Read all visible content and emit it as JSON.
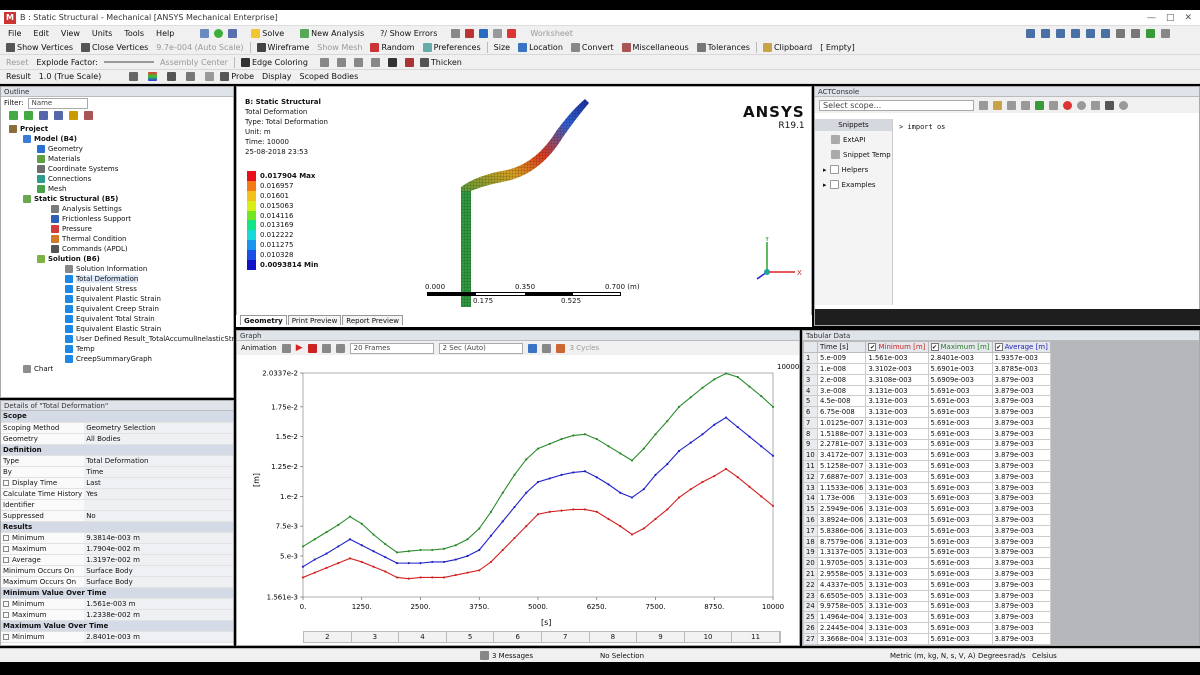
{
  "window": {
    "title": "B : Static Structural - Mechanical [ANSYS Mechanical Enterprise]",
    "app_letter": "M"
  },
  "menu": [
    "File",
    "Edit",
    "View",
    "Units",
    "Tools",
    "Help"
  ],
  "toolbar1": {
    "solve": "Solve",
    "new_analysis": "New Analysis",
    "show_errors": "?/ Show Errors",
    "worksheet": "Worksheet"
  },
  "toolbar2": {
    "show_vertices": "Show Vertices",
    "close_vertices": "Close Vertices",
    "scale": "9.7e-004 (Auto Scale)",
    "wireframe": "Wireframe",
    "show_mesh": "Show Mesh",
    "random": "Random",
    "preferences": "Preferences",
    "size": "Size",
    "location": "Location",
    "convert": "Convert",
    "miscellaneous": "Miscellaneous",
    "tolerances": "Tolerances",
    "clipboard": "Clipboard",
    "empty": "[ Empty]"
  },
  "toolbar3": {
    "reset": "Reset",
    "explode": "Explode Factor:",
    "assembly": "Assembly Center",
    "edge_coloring": "Edge Coloring",
    "thicken": "Thicken"
  },
  "toolbar4": {
    "result": "Result",
    "true_scale": "1.0 (True Scale)",
    "probe": "Probe",
    "display": "Display",
    "scoped": "Scoped Bodies"
  },
  "outline": {
    "header": "Outline",
    "filter_label": "Filter:",
    "filter_value": "Name",
    "items": [
      {
        "label": "Project",
        "lvl": 0,
        "color": "#8a6d3b",
        "bold": true
      },
      {
        "label": "Model (B4)",
        "lvl": 1,
        "color": "#3d7bd9",
        "bold": true
      },
      {
        "label": "Geometry",
        "lvl": 2,
        "color": "#2a6fd6"
      },
      {
        "label": "Materials",
        "lvl": 2,
        "color": "#5fa040"
      },
      {
        "label": "Coordinate Systems",
        "lvl": 2,
        "color": "#6d6d6d"
      },
      {
        "label": "Connections",
        "lvl": 2,
        "color": "#2a9d8f"
      },
      {
        "label": "Mesh",
        "lvl": 2,
        "color": "#4aa04a"
      },
      {
        "label": "Static Structural (B5)",
        "lvl": 1,
        "color": "#6aa84f",
        "bold": true
      },
      {
        "label": "Analysis Settings",
        "lvl": 3,
        "color": "#7a7a7a"
      },
      {
        "label": "Frictionless Support",
        "lvl": 3,
        "color": "#2b5fb8"
      },
      {
        "label": "Pressure",
        "lvl": 3,
        "color": "#d23c3c"
      },
      {
        "label": "Thermal Condition",
        "lvl": 3,
        "color": "#d27a2c"
      },
      {
        "label": "Commands (APDL)",
        "lvl": 3,
        "color": "#555"
      },
      {
        "label": "Solution (B6)",
        "lvl": 2,
        "color": "#7cb342",
        "bold": true
      },
      {
        "label": "Solution Information",
        "lvl": 4,
        "color": "#888"
      },
      {
        "label": "Total Deformation",
        "lvl": 4,
        "color": "#1e88e5",
        "sel": true
      },
      {
        "label": "Equivalent Stress",
        "lvl": 4,
        "color": "#1e88e5"
      },
      {
        "label": "Equivalent Plastic Strain",
        "lvl": 4,
        "color": "#1e88e5"
      },
      {
        "label": "Equivalent Creep Strain",
        "lvl": 4,
        "color": "#1e88e5"
      },
      {
        "label": "Equivalent Total Strain",
        "lvl": 4,
        "color": "#1e88e5"
      },
      {
        "label": "Equivalent Elastic Strain",
        "lvl": 4,
        "color": "#1e88e5"
      },
      {
        "label": "User Defined Result_TotalAccumulInelasticStrain",
        "lvl": 4,
        "color": "#1e88e5"
      },
      {
        "label": "Temp",
        "lvl": 4,
        "color": "#1e88e5"
      },
      {
        "label": "CreepSummaryGraph",
        "lvl": 4,
        "color": "#1e88e5"
      },
      {
        "label": "Chart",
        "lvl": 1,
        "color": "#8e8e8e"
      }
    ]
  },
  "details": {
    "header": "Details of \"Total Deformation\"",
    "rows": [
      {
        "g": "Scope"
      },
      {
        "k": "Scoping Method",
        "v": "Geometry Selection"
      },
      {
        "k": "Geometry",
        "v": "All Bodies"
      },
      {
        "g": "Definition"
      },
      {
        "k": "Type",
        "v": "Total Deformation"
      },
      {
        "k": "By",
        "v": "Time"
      },
      {
        "k": "Display Time",
        "v": "Last",
        "cb": true
      },
      {
        "k": "Calculate Time History",
        "v": "Yes"
      },
      {
        "k": "Identifier",
        "v": ""
      },
      {
        "k": "Suppressed",
        "v": "No"
      },
      {
        "g": "Results"
      },
      {
        "k": "Minimum",
        "v": "9.3814e-003 m",
        "cb": true
      },
      {
        "k": "Maximum",
        "v": "1.7904e-002 m",
        "cb": true
      },
      {
        "k": "Average",
        "v": "1.3197e-002 m",
        "cb": true
      },
      {
        "k": "Minimum Occurs On",
        "v": "Surface Body"
      },
      {
        "k": "Maximum Occurs On",
        "v": "Surface Body"
      },
      {
        "g": "Minimum Value Over Time"
      },
      {
        "k": "Minimum",
        "v": "1.561e-003 m",
        "cb": true
      },
      {
        "k": "Maximum",
        "v": "1.2338e-002 m",
        "cb": true
      },
      {
        "g": "Maximum Value Over Time"
      },
      {
        "k": "Minimum",
        "v": "2.8401e-003 m",
        "cb": true
      }
    ]
  },
  "viewport": {
    "title": "B: Static Structural",
    "l1": "Total Deformation",
    "l2": "Type: Total Deformation",
    "l3": "Unit: m",
    "l4": "Time: 10000",
    "l5": "25-08-2018 23:53",
    "brand": "ANSYS",
    "version": "R19.1",
    "legend": [
      "0.017904 Max",
      "0.016957",
      "0.01601",
      "0.015063",
      "0.014116",
      "0.013169",
      "0.012222",
      "0.011275",
      "0.010328",
      "0.0093814 Min"
    ],
    "legend_colors": [
      "#e8111b",
      "#f57a16",
      "#f2c21b",
      "#d7ef14",
      "#72e620",
      "#14e488",
      "#18d8d8",
      "#1a94ee",
      "#1a4fe8",
      "#1111c8"
    ],
    "scale_labels": [
      "0.000",
      "0.350",
      "0.700 (m)",
      "0.175",
      "0.525"
    ],
    "tabs": [
      "Geometry",
      "Print Preview",
      "Report Preview"
    ]
  },
  "act": {
    "header": "ACTConsole",
    "scope": "Select scope...",
    "snippets": "Snippets",
    "items": [
      "ExtAPI",
      "Snippet Temp"
    ],
    "folders": [
      "Helpers",
      "Examples"
    ],
    "code": "import os"
  },
  "graph": {
    "header": "Graph",
    "animation": "Animation",
    "frames": "20 Frames",
    "duration": "2 Sec (Auto)",
    "cycles": "3 Cycles",
    "max_label": "10000",
    "yunit": "[m]",
    "xunit": "[s]",
    "bottom": [
      "2",
      "3",
      "4",
      "5",
      "6",
      "7",
      "8",
      "9",
      "10",
      "11"
    ]
  },
  "chart_data": {
    "type": "line",
    "x": [
      0,
      250,
      500,
      750,
      1000,
      1250,
      1500,
      1750,
      2000,
      2250,
      2500,
      2750,
      3000,
      3250,
      3500,
      3750,
      4000,
      4250,
      4500,
      4750,
      5000,
      5250,
      5500,
      5750,
      6000,
      6250,
      6500,
      6750,
      7000,
      7250,
      7500,
      7750,
      8000,
      8250,
      8500,
      8750,
      9000,
      9250,
      9500,
      9750,
      10000
    ],
    "series": [
      {
        "name": "Minimum [m]",
        "color": "#d22020",
        "values": [
          0.0032,
          0.0036,
          0.004,
          0.0044,
          0.0048,
          0.0045,
          0.0041,
          0.0037,
          0.0032,
          0.0031,
          0.0032,
          0.0032,
          0.0032,
          0.0034,
          0.0036,
          0.0038,
          0.0045,
          0.0055,
          0.0065,
          0.0075,
          0.0085,
          0.0087,
          0.0088,
          0.0089,
          0.0089,
          0.0087,
          0.0081,
          0.0075,
          0.0068,
          0.0073,
          0.0081,
          0.0089,
          0.0099,
          0.0106,
          0.0112,
          0.0117,
          0.0123,
          0.0116,
          0.0108,
          0.01,
          0.0092
        ]
      },
      {
        "name": "Maximum [m]",
        "color": "#2a8a2a",
        "values": [
          0.0058,
          0.0064,
          0.007,
          0.0076,
          0.0083,
          0.0077,
          0.0068,
          0.006,
          0.0053,
          0.0054,
          0.0055,
          0.0055,
          0.0056,
          0.0059,
          0.0064,
          0.0073,
          0.0087,
          0.0103,
          0.0118,
          0.0131,
          0.014,
          0.0144,
          0.0148,
          0.0151,
          0.0152,
          0.0148,
          0.0142,
          0.0136,
          0.013,
          0.014,
          0.0152,
          0.0163,
          0.0175,
          0.0183,
          0.0191,
          0.0198,
          0.0203,
          0.02,
          0.0192,
          0.0184,
          0.0175
        ]
      },
      {
        "name": "Average [m]",
        "color": "#2020c8",
        "values": [
          0.0041,
          0.0047,
          0.0052,
          0.0058,
          0.0064,
          0.0059,
          0.0054,
          0.0049,
          0.0044,
          0.0044,
          0.0044,
          0.0045,
          0.0045,
          0.0047,
          0.005,
          0.0055,
          0.0067,
          0.0079,
          0.0091,
          0.0103,
          0.0112,
          0.0115,
          0.0118,
          0.012,
          0.0121,
          0.0116,
          0.011,
          0.0103,
          0.0099,
          0.0106,
          0.0118,
          0.0127,
          0.0138,
          0.0145,
          0.0152,
          0.016,
          0.0166,
          0.0158,
          0.015,
          0.0142,
          0.0134
        ]
      }
    ],
    "ytick_labels": [
      "2.0337e-2",
      "1.75e-2",
      "1.5e-2",
      "1.25e-2",
      "1.e-2",
      "7.5e-3",
      "5.e-3",
      "1.561e-3"
    ],
    "ytick_values": [
      0.020337,
      0.0175,
      0.015,
      0.0125,
      0.01,
      0.0075,
      0.005,
      0.001561
    ],
    "xtick_labels": [
      "0.",
      "1250.",
      "2500.",
      "3750.",
      "5000.",
      "6250.",
      "7500.",
      "8750.",
      "10000"
    ],
    "ylim": [
      0.001561,
      0.020337
    ],
    "xlim": [
      0,
      10000
    ],
    "ylabel": "[m]",
    "xlabel": "[s]"
  },
  "tabular": {
    "header": "Tabular Data",
    "cols": [
      "Time [s]",
      "Minimum [m]",
      "Maximum [m]",
      "Average [m]"
    ],
    "rows": [
      [
        "1",
        "5.e-009",
        "1.561e-003",
        "2.8401e-003",
        "1.9357e-003"
      ],
      [
        "2",
        "1.e-008",
        "3.3102e-003",
        "5.6901e-003",
        "3.8785e-003"
      ],
      [
        "3",
        "2.e-008",
        "3.3108e-003",
        "5.6909e-003",
        "3.879e-003"
      ],
      [
        "4",
        "3.e-008",
        "3.131e-003",
        "5.691e-003",
        "3.879e-003"
      ],
      [
        "5",
        "4.5e-008",
        "3.131e-003",
        "5.691e-003",
        "3.879e-003"
      ],
      [
        "6",
        "6.75e-008",
        "3.131e-003",
        "5.691e-003",
        "3.879e-003"
      ],
      [
        "7",
        "1.0125e-007",
        "3.131e-003",
        "5.691e-003",
        "3.879e-003"
      ],
      [
        "8",
        "1.5188e-007",
        "3.131e-003",
        "5.691e-003",
        "3.879e-003"
      ],
      [
        "9",
        "2.2781e-007",
        "3.131e-003",
        "5.691e-003",
        "3.879e-003"
      ],
      [
        "10",
        "3.4172e-007",
        "3.131e-003",
        "5.691e-003",
        "3.879e-003"
      ],
      [
        "11",
        "5.1258e-007",
        "3.131e-003",
        "5.691e-003",
        "3.879e-003"
      ],
      [
        "12",
        "7.6887e-007",
        "3.131e-003",
        "5.691e-003",
        "3.879e-003"
      ],
      [
        "13",
        "1.1533e-006",
        "3.131e-003",
        "5.691e-003",
        "3.879e-003"
      ],
      [
        "14",
        "1.73e-006",
        "3.131e-003",
        "5.691e-003",
        "3.879e-003"
      ],
      [
        "15",
        "2.5949e-006",
        "3.131e-003",
        "5.691e-003",
        "3.879e-003"
      ],
      [
        "16",
        "3.8924e-006",
        "3.131e-003",
        "5.691e-003",
        "3.879e-003"
      ],
      [
        "17",
        "5.8386e-006",
        "3.131e-003",
        "5.691e-003",
        "3.879e-003"
      ],
      [
        "18",
        "8.7579e-006",
        "3.131e-003",
        "5.691e-003",
        "3.879e-003"
      ],
      [
        "19",
        "1.3137e-005",
        "3.131e-003",
        "5.691e-003",
        "3.879e-003"
      ],
      [
        "20",
        "1.9705e-005",
        "3.131e-003",
        "5.691e-003",
        "3.879e-003"
      ],
      [
        "21",
        "2.9558e-005",
        "3.131e-003",
        "5.691e-003",
        "3.879e-003"
      ],
      [
        "22",
        "4.4337e-005",
        "3.131e-003",
        "5.691e-003",
        "3.879e-003"
      ],
      [
        "23",
        "6.6505e-005",
        "3.131e-003",
        "5.691e-003",
        "3.879e-003"
      ],
      [
        "24",
        "9.9758e-005",
        "3.131e-003",
        "5.691e-003",
        "3.879e-003"
      ],
      [
        "25",
        "1.4964e-004",
        "3.131e-003",
        "5.691e-003",
        "3.879e-003"
      ],
      [
        "26",
        "2.2445e-004",
        "3.131e-003",
        "5.691e-003",
        "3.879e-003"
      ],
      [
        "27",
        "3.3668e-004",
        "3.131e-003",
        "5.691e-003",
        "3.879e-003"
      ]
    ]
  },
  "status": {
    "messages": "3 Messages",
    "selection": "No Selection",
    "units": "Metric (m, kg, N, s, V, A)",
    "degrees": "Degrees",
    "rads": "rad/s",
    "celsius": "Celsius"
  }
}
